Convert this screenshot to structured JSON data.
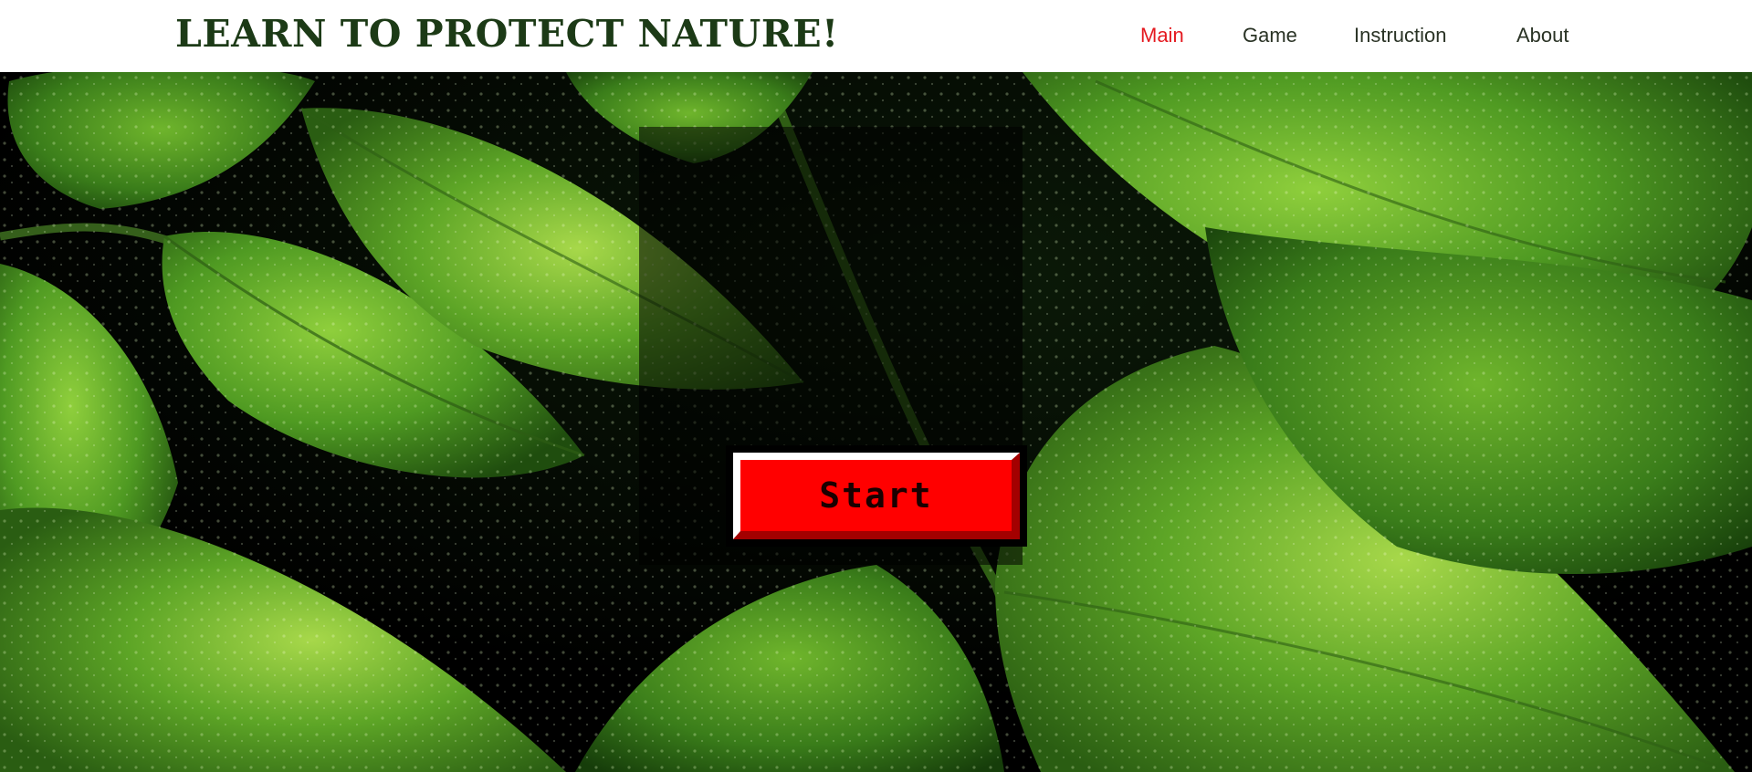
{
  "header": {
    "title": "LEARN TO PROTECT NATURE!"
  },
  "nav": {
    "items": [
      {
        "label": "Main",
        "active": true
      },
      {
        "label": "Game",
        "active": false
      },
      {
        "label": "Instruction",
        "active": false
      },
      {
        "label": "About",
        "active": false
      }
    ]
  },
  "hero": {
    "background": "green-leaves-with-water-drops-photo",
    "start_label": "Start"
  },
  "colors": {
    "accent": "#e4191f",
    "title": "#1c3a16",
    "button": "#ff0000"
  }
}
